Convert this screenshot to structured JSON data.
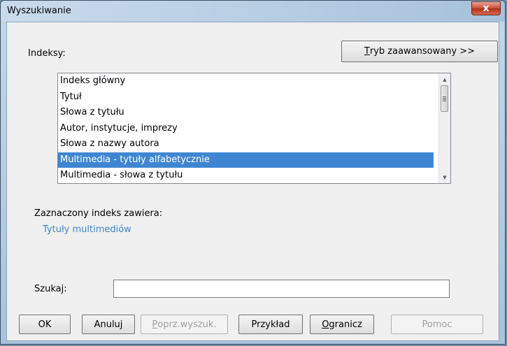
{
  "window": {
    "title": "Wyszukiwanie",
    "close_glyph": "x"
  },
  "indexes_label": "Indeksy:",
  "advanced_button": {
    "prefix": "T",
    "rest": "ryb zaawansowany >>"
  },
  "index_list": {
    "items": [
      "Indeks główny",
      "Tytuł",
      "Słowa z tytułu",
      "Autor, instytucje, imprezy",
      "Słowa z nazwy autora",
      "Multimedia - tytuły alfabetycznie",
      "Multimedia - słowa z tytułu"
    ],
    "selected_index": 5
  },
  "selected_contains_label": "Zaznaczony indeks zawiera:",
  "selected_contains_value": "Tytuły multimediów",
  "search": {
    "label": "Szukaj:",
    "value": ""
  },
  "buttons": {
    "ok": "OK",
    "cancel": "Anuluj",
    "prev_search_prefix": "P",
    "prev_search_rest": "oprz.wyszuk.",
    "example": "Przykład",
    "restrict_prefix": "O",
    "restrict_rest": "granicz",
    "help": "Pomoc"
  },
  "colors": {
    "accent": "#3f86d2",
    "link_text": "#3f86d2"
  }
}
